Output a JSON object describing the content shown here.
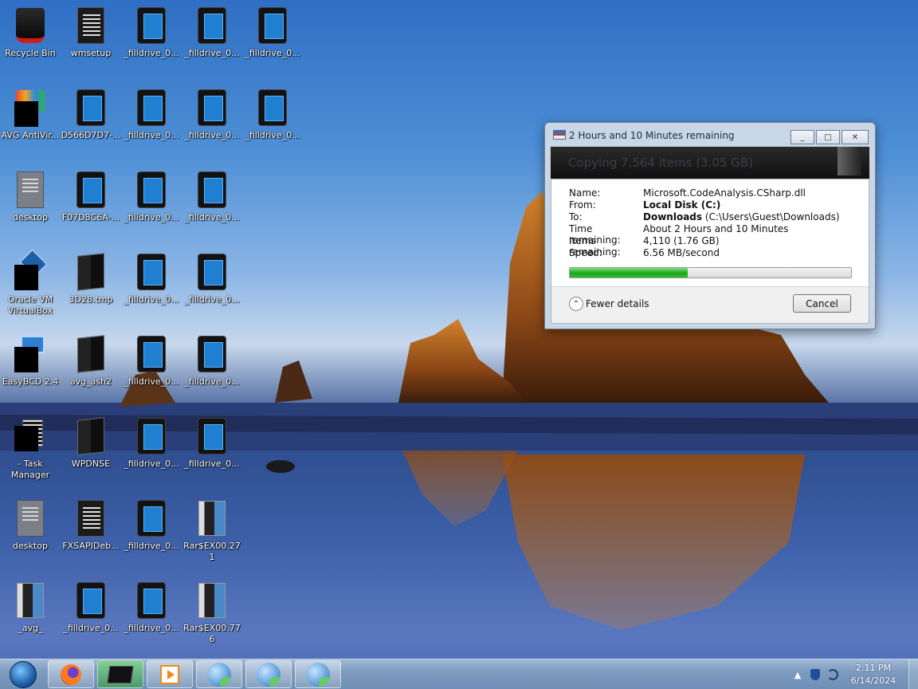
{
  "desktop": {
    "icons": [
      {
        "label": "Recycle Bin",
        "icon": "recycle-bin-icon"
      },
      {
        "label": "wmsetup",
        "icon": "document-icon"
      },
      {
        "label": "_filldrive_0...",
        "icon": "tablet-file-icon"
      },
      {
        "label": "_filldrive_0...",
        "icon": "tablet-file-icon"
      },
      {
        "label": "_filldrive_0...",
        "icon": "tablet-file-icon"
      },
      {
        "label": "AVG AntiVir...",
        "icon": "avg-antivirus-icon"
      },
      {
        "label": "D566D7D7-...",
        "icon": "tablet-file-icon"
      },
      {
        "label": "_filldrive_0...",
        "icon": "tablet-file-icon"
      },
      {
        "label": "_filldrive_0...",
        "icon": "tablet-file-icon"
      },
      {
        "label": "_filldrive_0...",
        "icon": "tablet-file-icon"
      },
      {
        "label": "desktop",
        "icon": "settings-file-icon"
      },
      {
        "label": "F07D8C6A-...",
        "icon": "tablet-file-icon"
      },
      {
        "label": "_filldrive_0...",
        "icon": "tablet-file-icon"
      },
      {
        "label": "_filldrive_0...",
        "icon": "tablet-file-icon"
      },
      {
        "label": "Oracle VM VirtualBox",
        "icon": "virtualbox-icon"
      },
      {
        "label": "3D28.tmp",
        "icon": "folder-icon"
      },
      {
        "label": "_filldrive_0...",
        "icon": "tablet-file-icon"
      },
      {
        "label": "_filldrive_0...",
        "icon": "tablet-file-icon"
      },
      {
        "label": "EasyBCD 2.4",
        "icon": "easybcd-icon"
      },
      {
        "label": "avg_ash2",
        "icon": "folder-icon"
      },
      {
        "label": "_filldrive_0...",
        "icon": "tablet-file-icon"
      },
      {
        "label": "_filldrive_0...",
        "icon": "tablet-file-icon"
      },
      {
        "label": "- Task Manager",
        "icon": "task-manager-icon"
      },
      {
        "label": "WPDNSE",
        "icon": "folder-icon"
      },
      {
        "label": "_filldrive_0...",
        "icon": "tablet-file-icon"
      },
      {
        "label": "_filldrive_0...",
        "icon": "tablet-file-icon"
      },
      {
        "label": "desktop",
        "icon": "settings-file-icon"
      },
      {
        "label": "FXSAPIDeb...",
        "icon": "document-icon"
      },
      {
        "label": "_filldrive_0...",
        "icon": "tablet-file-icon"
      },
      {
        "label": "Rar$EX00.271",
        "icon": "rar-folder-icon"
      },
      {
        "label": "_avg_",
        "icon": "rar-folder-icon"
      },
      {
        "label": "_filldrive_0...",
        "icon": "tablet-file-icon"
      },
      {
        "label": "_filldrive_0...",
        "icon": "tablet-file-icon"
      },
      {
        "label": "Rar$EX00.776",
        "icon": "rar-folder-icon"
      }
    ]
  },
  "dialog": {
    "title": "2 Hours and 10 Minutes remaining",
    "minimize": "_",
    "maximize": "□",
    "close": "✕",
    "header": "Copying 7,564 items (3.05 GB)",
    "name_label": "Name:",
    "name_value": "Microsoft.CodeAnalysis.CSharp.dll",
    "from_label": "From:",
    "from_value": "Local Disk (C:)",
    "to_label": "To:",
    "to_value_bold": "Downloads",
    "to_value_rest": " (C:\\Users\\Guest\\Downloads)",
    "time_label": "Time remaining:",
    "time_value": "About 2 Hours and 10 Minutes",
    "items_label": "Items remaining:",
    "items_value": "4,110 (1.76 GB)",
    "speed_label": "Speed:",
    "speed_value": "6.56 MB/second",
    "progress_fraction": 0.42,
    "fewer_details": "Fewer details",
    "fewer_icon": "⌃",
    "cancel": "Cancel"
  },
  "taskbar": {
    "apps": [
      "firefox-icon",
      "terminal-icon",
      "media-player-icon",
      "sphere-app-icon",
      "sphere-app-icon",
      "sphere-app-icon"
    ],
    "tray_arrow": "▲",
    "time": "2:11 PM",
    "date": "6/14/2024"
  },
  "colors": {
    "progress": "#1aa51a",
    "taskbar": "#7f9cbf",
    "dialog_frame": "#c9d6e5"
  }
}
